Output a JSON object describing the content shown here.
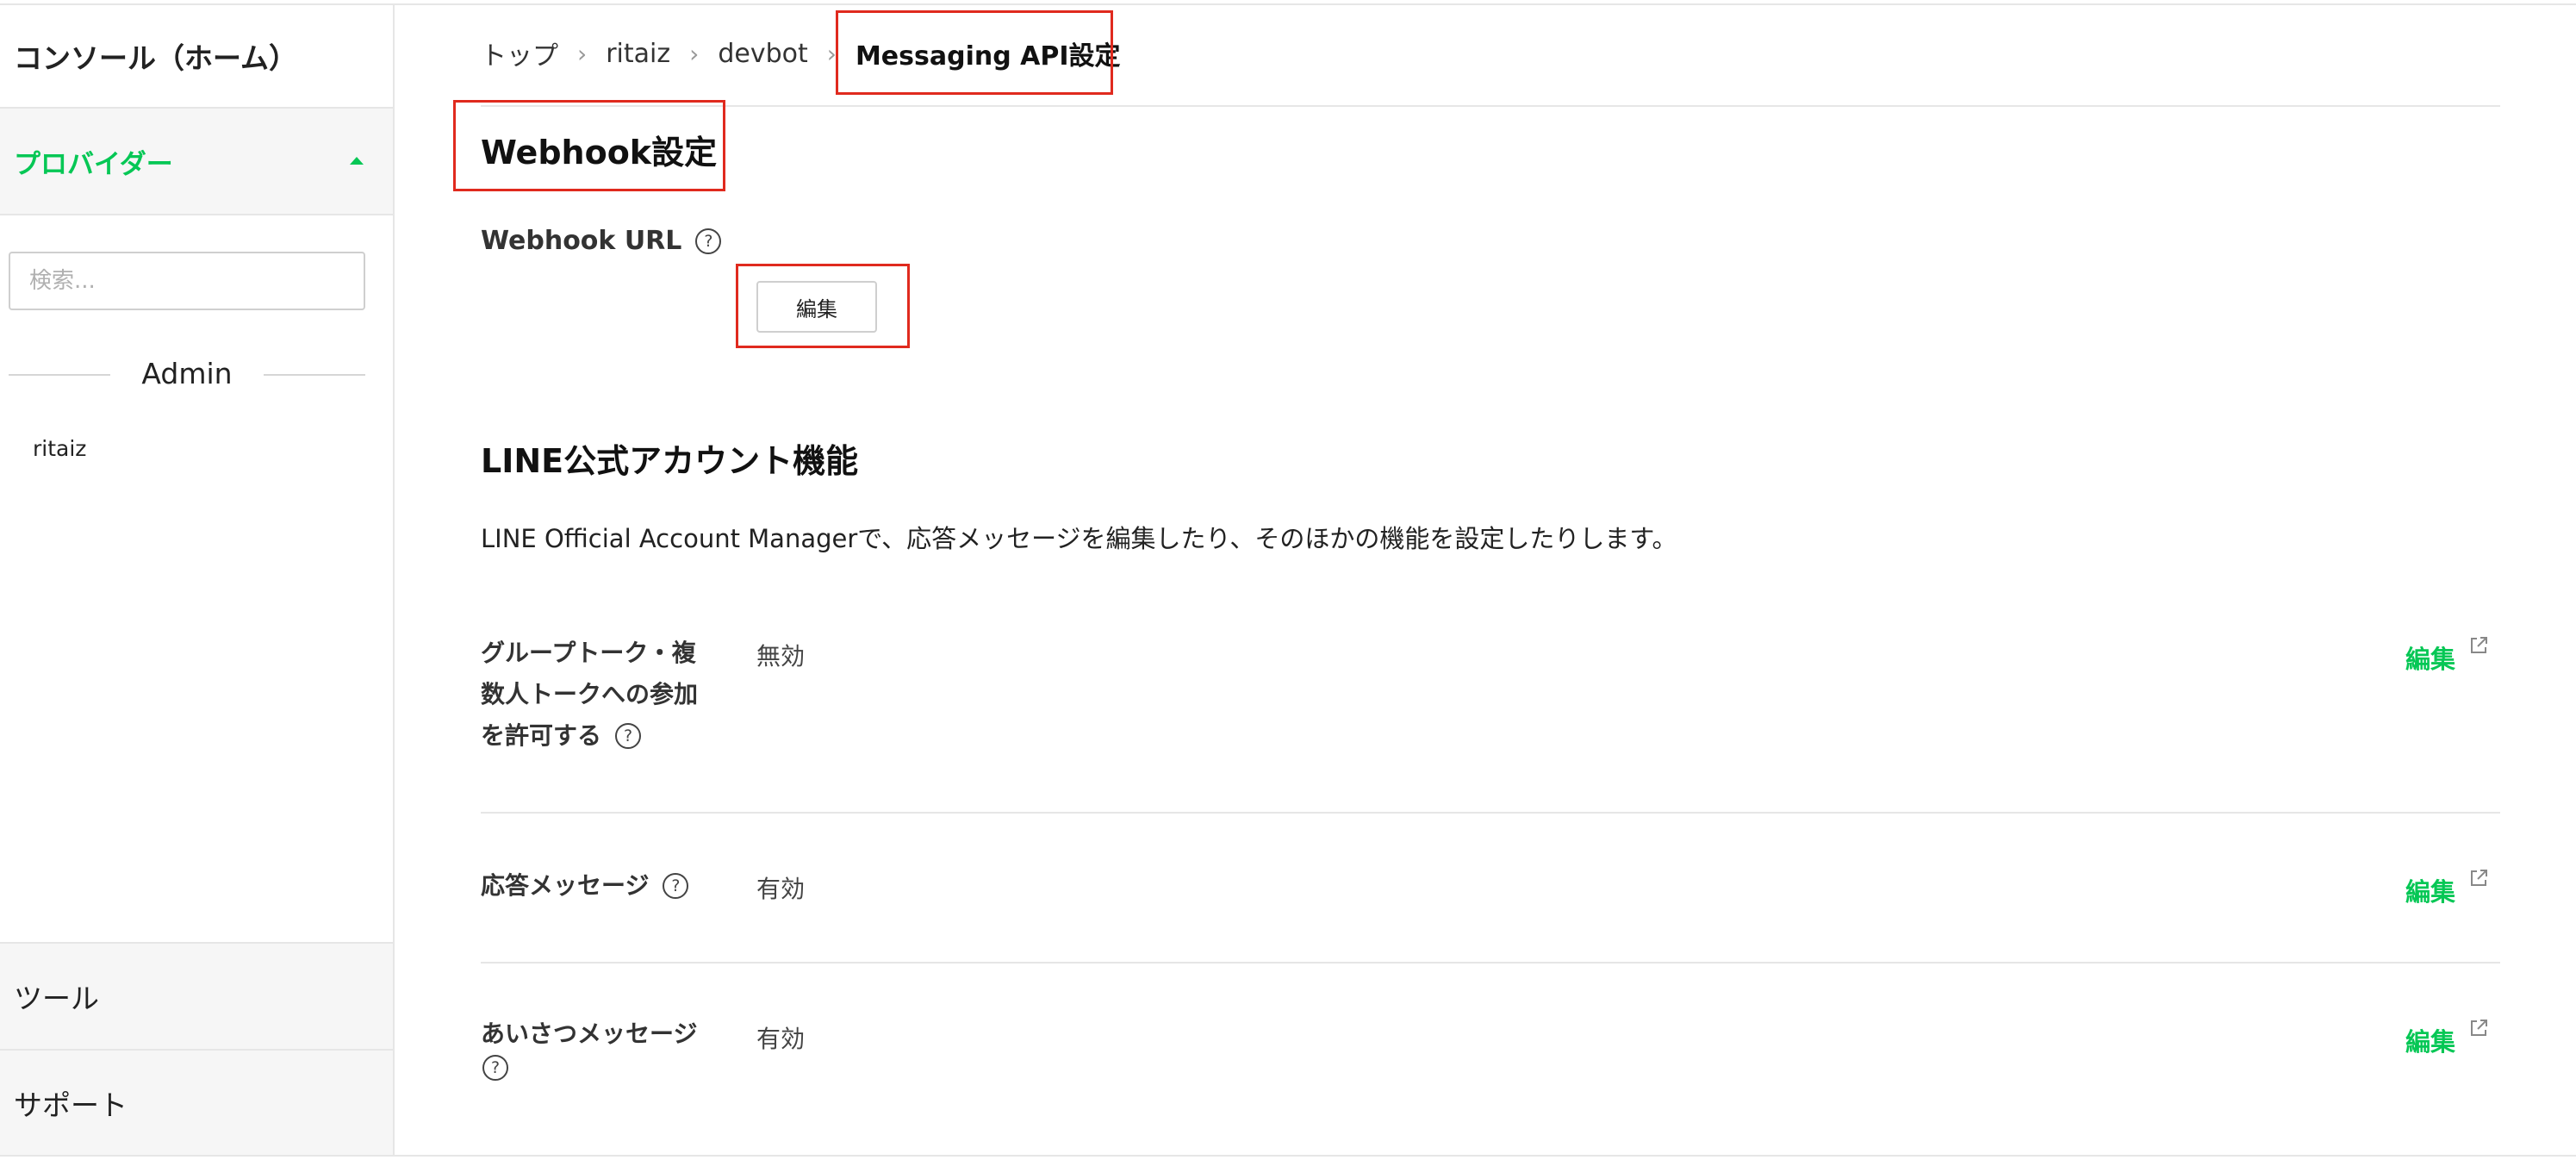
{
  "sidebar": {
    "home_label": "コンソール（ホーム）",
    "provider_label": "プロバイダー",
    "search_placeholder": "検索...",
    "admin_label": "Admin",
    "provider_item": "ritaiz",
    "tools_label": "ツール",
    "support_label": "サポート"
  },
  "breadcrumb": {
    "items": [
      "トップ",
      "ritaiz",
      "devbot"
    ],
    "current": "Messaging API設定",
    "separator": "›"
  },
  "webhook": {
    "title": "Webhook設定",
    "url_label": "Webhook URL",
    "edit_button": "編集"
  },
  "oa_features": {
    "title": "LINE公式アカウント機能",
    "description": "LINE Official Account Managerで、応答メッセージを編集したり、そのほかの機能を設定したりします。",
    "rows": [
      {
        "label_lines": [
          "グループトーク・複",
          "数人トークへの参加",
          "を許可する"
        ],
        "value": "無効",
        "edit": "編集"
      },
      {
        "label_lines": [
          "応答メッセージ"
        ],
        "value": "有効",
        "edit": "編集"
      },
      {
        "label_lines": [
          "あいさつメッセージ"
        ],
        "value": "有効",
        "edit": "編集"
      }
    ]
  },
  "help_glyph": "?",
  "icons": {
    "help": "question-circle-icon",
    "external": "external-link-icon",
    "caret": "caret-up-icon",
    "breadcrumb_separator": "chevron-right-icon"
  },
  "colors": {
    "brand_green": "#06c755",
    "highlight_red": "#e02a1e",
    "sidebar_bg": "#f6f6f6",
    "border": "#e6e6e6"
  }
}
